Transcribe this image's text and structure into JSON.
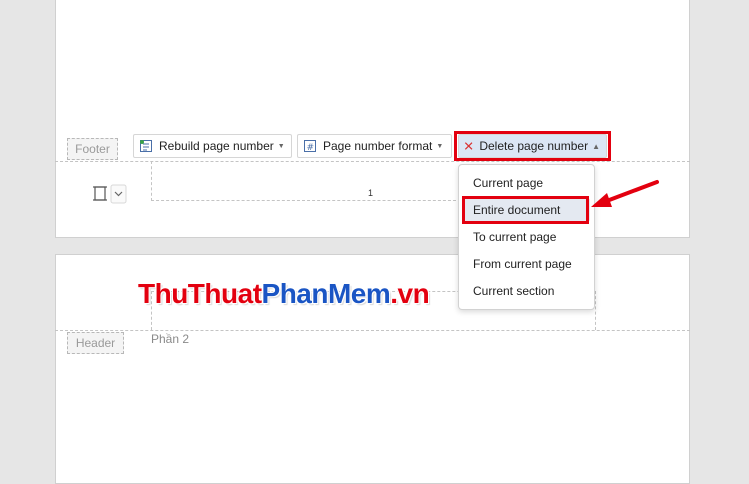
{
  "footer_tag": "Footer",
  "header_tag": "Header",
  "toolbar": {
    "rebuild_label": "Rebuild page number",
    "format_label": "Page number format",
    "delete_label": "Delete page number"
  },
  "page_number": "1",
  "section_label": "Phần 2",
  "delete_menu": {
    "items": [
      "Current page",
      "Entire document",
      "To current page",
      "From current page",
      "Current section"
    ],
    "highlighted_index": 1
  },
  "watermark": {
    "part1": "ThuThuat",
    "part2": "PhanMem",
    "part3": ".vn"
  },
  "colors": {
    "annotation_red": "#e3000f",
    "watermark_red": "#e3000f",
    "watermark_blue": "#1a55c4",
    "menu_highlight": "#e4e9f1",
    "active_button": "#dbe6f5"
  }
}
